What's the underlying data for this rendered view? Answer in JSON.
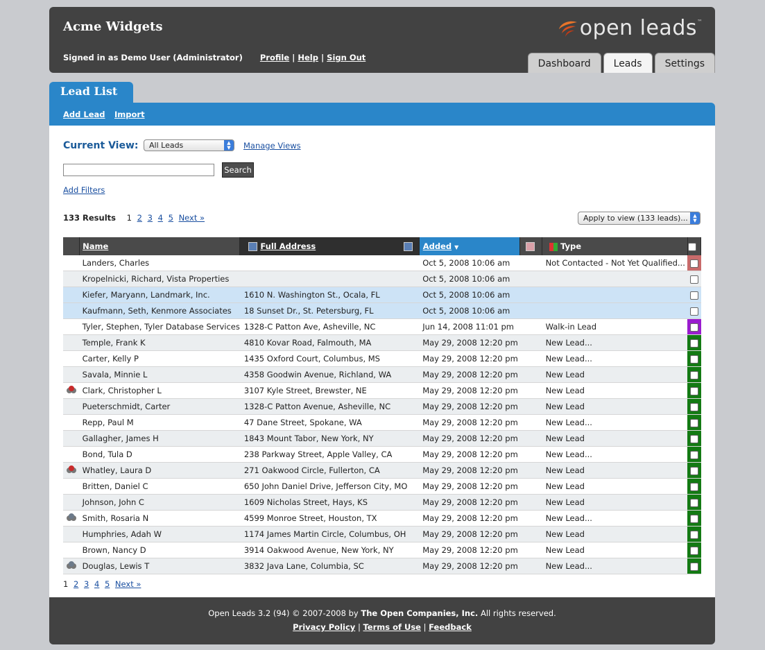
{
  "app": {
    "company": "Acme Widgets",
    "signed_in_text": "Signed in as Demo User (Administrator)",
    "profile_link": "Profile",
    "help_link": "Help",
    "signout_link": "Sign Out",
    "logo_text": "open leads",
    "logo_tm": "™",
    "sep": "|"
  },
  "nav_tabs": [
    {
      "label": "Dashboard",
      "active": false
    },
    {
      "label": "Leads",
      "active": true
    },
    {
      "label": "Settings",
      "active": false
    }
  ],
  "page": {
    "title": "Lead List",
    "add_lead": "Add Lead",
    "import": "Import",
    "current_view_label": "Current View:",
    "current_view_value": "All Leads",
    "manage_views": "Manage Views",
    "search_value": "",
    "search_button": "Search",
    "add_filters": "Add Filters",
    "results_text": "133 Results",
    "apply_view": "Apply to view (133 leads)..."
  },
  "pagination": {
    "current": "1",
    "pages": [
      "2",
      "3",
      "4",
      "5"
    ],
    "next": "Next »"
  },
  "table": {
    "columns": {
      "name": "Name",
      "address": "Full Address",
      "added": "Added",
      "added_sort_indicator": "▼",
      "type": "Type"
    },
    "rows": [
      {
        "icon": "",
        "name": "Landers, Charles",
        "address": "",
        "added": "Oct 5, 2008 10:06 am",
        "type": "Not Contacted - Not Yet Qualified...",
        "flag": "#c96b6b",
        "style": "white"
      },
      {
        "icon": "",
        "name": "Kropelnicki, Richard, Vista Properties",
        "address": "",
        "added": "Oct 5, 2008 10:06 am",
        "type": "",
        "flag": "",
        "style": "gray"
      },
      {
        "icon": "",
        "name": "Kiefer, Maryann, Landmark, Inc.",
        "address": "1610 N. Washington St., Ocala, FL",
        "added": "Oct 5, 2008 10:06 am",
        "type": "",
        "flag": "",
        "style": "blue"
      },
      {
        "icon": "",
        "name": "Kaufmann, Seth, Kenmore Associates",
        "address": "18 Sunset Dr., St. Petersburg, FL",
        "added": "Oct 5, 2008 10:06 am",
        "type": "",
        "flag": "",
        "style": "blue"
      },
      {
        "icon": "",
        "name": "Tyler, Stephen, Tyler Database Services",
        "address": "1328-C Patton Ave, Asheville, NC",
        "added": "Jun 14, 2008 11:01 pm",
        "type": "Walk-in Lead",
        "flag": "#9a1ccf",
        "style": "white"
      },
      {
        "icon": "",
        "name": "Temple, Frank K",
        "address": "4810 Kovar Road, Falmouth, MA",
        "added": "May 29, 2008 12:20 pm",
        "type": "New Lead...",
        "flag": "#137a13",
        "style": "gray"
      },
      {
        "icon": "",
        "name": "Carter, Kelly P",
        "address": "1435 Oxford Court, Columbus, MS",
        "added": "May 29, 2008 12:20 pm",
        "type": "New Lead...",
        "flag": "#137a13",
        "style": "white"
      },
      {
        "icon": "",
        "name": "Savala, Minnie L",
        "address": "4358 Goodwin Avenue, Richland, WA",
        "added": "May 29, 2008 12:20 pm",
        "type": "New Lead",
        "flag": "#137a13",
        "style": "gray"
      },
      {
        "icon": "red",
        "name": "Clark, Christopher L",
        "address": "3107 Kyle Street, Brewster, NE",
        "added": "May 29, 2008 12:20 pm",
        "type": "New Lead",
        "flag": "#137a13",
        "style": "white"
      },
      {
        "icon": "",
        "name": "Pueterschmidt, Carter",
        "address": "1328-C Patton Avenue, Asheville, NC",
        "added": "May 29, 2008 12:20 pm",
        "type": "New Lead",
        "flag": "#137a13",
        "style": "gray"
      },
      {
        "icon": "",
        "name": "Repp, Paul M",
        "address": "47 Dane Street, Spokane, WA",
        "added": "May 29, 2008 12:20 pm",
        "type": "New Lead...",
        "flag": "#137a13",
        "style": "white"
      },
      {
        "icon": "",
        "name": "Gallagher, James H",
        "address": "1843 Mount Tabor, New York, NY",
        "added": "May 29, 2008 12:20 pm",
        "type": "New Lead",
        "flag": "#137a13",
        "style": "gray"
      },
      {
        "icon": "",
        "name": "Bond, Tula D",
        "address": "238 Parkway Street, Apple Valley, CA",
        "added": "May 29, 2008 12:20 pm",
        "type": "New Lead...",
        "flag": "#137a13",
        "style": "white"
      },
      {
        "icon": "red",
        "name": "Whatley, Laura D",
        "address": "271 Oakwood Circle, Fullerton, CA",
        "added": "May 29, 2008 12:20 pm",
        "type": "New Lead",
        "flag": "#137a13",
        "style": "gray"
      },
      {
        "icon": "",
        "name": "Britten, Daniel C",
        "address": "650 John Daniel Drive, Jefferson City, MO",
        "added": "May 29, 2008 12:20 pm",
        "type": "New Lead",
        "flag": "#137a13",
        "style": "white"
      },
      {
        "icon": "",
        "name": "Johnson, John C",
        "address": "1609 Nicholas Street, Hays, KS",
        "added": "May 29, 2008 12:20 pm",
        "type": "New Lead",
        "flag": "#137a13",
        "style": "gray"
      },
      {
        "icon": "gray",
        "name": "Smith, Rosaria N",
        "address": "4599 Monroe Street, Houston, TX",
        "added": "May 29, 2008 12:20 pm",
        "type": "New Lead...",
        "flag": "#137a13",
        "style": "white"
      },
      {
        "icon": "",
        "name": "Humphries, Adah W",
        "address": "1174 James Martin Circle, Columbus, OH",
        "added": "May 29, 2008 12:20 pm",
        "type": "New Lead",
        "flag": "#137a13",
        "style": "gray"
      },
      {
        "icon": "",
        "name": "Brown, Nancy D",
        "address": "3914 Oakwood Avenue, New York, NY",
        "added": "May 29, 2008 12:20 pm",
        "type": "New Lead",
        "flag": "#137a13",
        "style": "white"
      },
      {
        "icon": "gray",
        "name": "Douglas, Lewis T",
        "address": "3832 Java Lane, Columbia, SC",
        "added": "May 29, 2008 12:20 pm",
        "type": "New Lead...",
        "flag": "#137a13",
        "style": "gray"
      }
    ]
  },
  "footer": {
    "line1_pre": "Open Leads 3.2 (94) © 2007-2008 by",
    "company": "The Open Companies, Inc.",
    "line1_post": "All rights reserved.",
    "privacy": "Privacy Policy",
    "terms": "Terms of Use",
    "feedback": "Feedback",
    "sep": "|"
  }
}
